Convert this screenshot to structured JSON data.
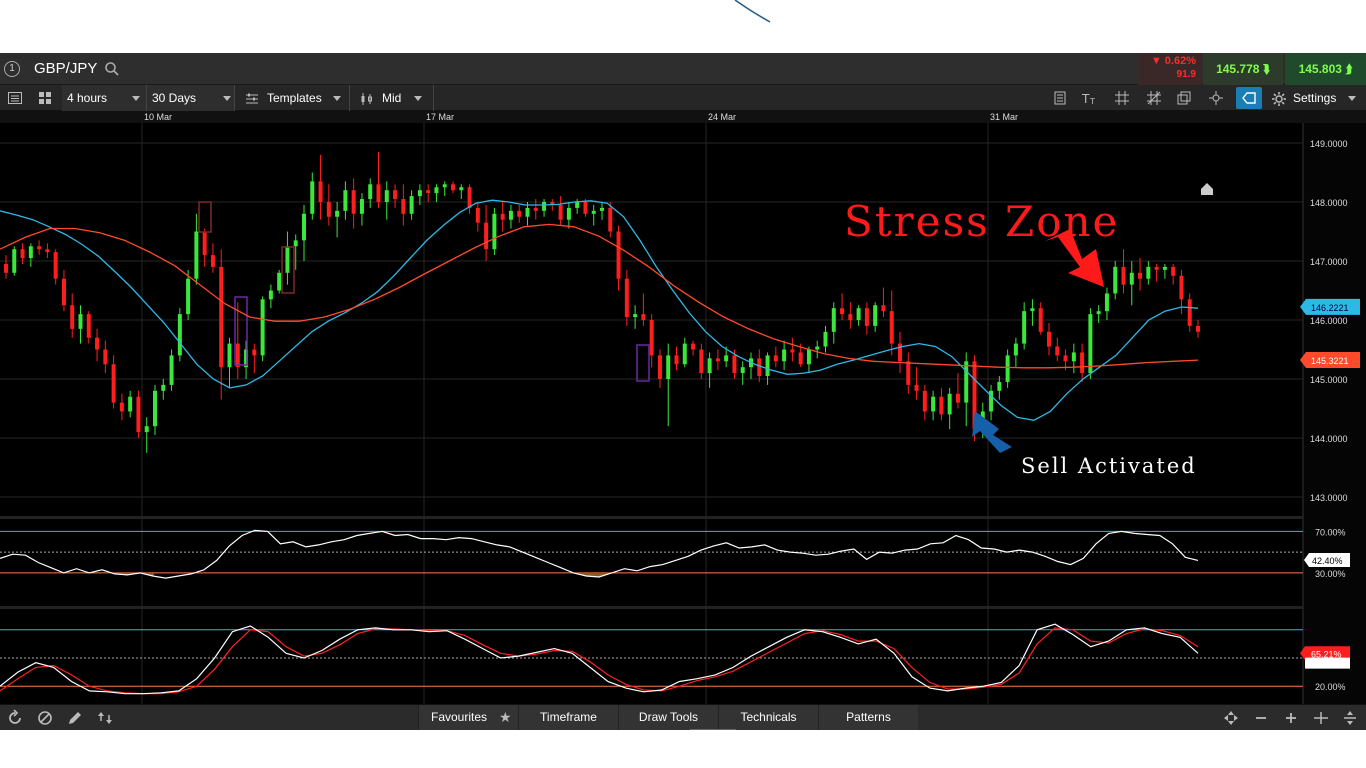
{
  "header": {
    "index_label": "1",
    "symbol": "GBP/JPY",
    "change_pct": "▼ 0.62%",
    "change_pts": "91.9",
    "bid": "145.778",
    "ask": "145.803"
  },
  "toolbar": {
    "interval": "4 hours",
    "range": "30 Days",
    "templates": "Templates",
    "price_type": "Mid",
    "settings": "Settings"
  },
  "bottombar": {
    "favourites": "Favourites",
    "timeframe": "Timeframe",
    "draw_tools": "Draw Tools",
    "technicals": "Technicals",
    "patterns": "Patterns"
  },
  "annotations": {
    "stress_zone": "Stress Zone",
    "sell_activated": "Sell Activated"
  },
  "colors": {
    "bull": "#39e83a",
    "bear": "#ff1e1e",
    "ma_fast": "#2db9e6",
    "ma_slow": "#ff4a2b",
    "annotation_red": "#ff1a1a",
    "arrow_blue": "#1560a8"
  },
  "chart_data": {
    "type": "candlestick",
    "symbol": "GBP/JPY",
    "x_labels": [
      "10 Mar",
      "17 Mar",
      "24 Mar",
      "31 Mar"
    ],
    "y_ticks": [
      "149.0000",
      "148.0000",
      "147.0000",
      "146.0000",
      "145.0000",
      "144.0000",
      "143.0000"
    ],
    "y_range": [
      143,
      149
    ],
    "price_tags": [
      {
        "value": "146.2221",
        "color": "#2db9e6"
      },
      {
        "value": "145.3221",
        "color": "#ff4a2b"
      }
    ],
    "ohlc": [
      [
        146.95,
        147.1,
        146.7,
        146.8
      ],
      [
        146.8,
        147.25,
        146.75,
        147.2
      ],
      [
        147.2,
        147.3,
        146.95,
        147.05
      ],
      [
        147.05,
        147.3,
        146.9,
        147.25
      ],
      [
        147.25,
        147.35,
        147.1,
        147.2
      ],
      [
        147.2,
        147.3,
        147.05,
        147.15
      ],
      [
        147.15,
        147.2,
        146.6,
        146.7
      ],
      [
        146.7,
        146.85,
        146.15,
        146.25
      ],
      [
        146.25,
        146.45,
        145.7,
        145.85
      ],
      [
        145.85,
        146.25,
        145.6,
        146.1
      ],
      [
        146.1,
        146.15,
        145.6,
        145.7
      ],
      [
        145.7,
        145.85,
        145.3,
        145.5
      ],
      [
        145.5,
        145.65,
        145.1,
        145.25
      ],
      [
        145.25,
        145.4,
        144.5,
        144.6
      ],
      [
        144.6,
        144.75,
        144.3,
        144.45
      ],
      [
        144.45,
        144.8,
        144.35,
        144.7
      ],
      [
        144.7,
        144.8,
        144.0,
        144.1
      ],
      [
        144.1,
        144.35,
        143.75,
        144.2
      ],
      [
        144.2,
        144.9,
        144.05,
        144.8
      ],
      [
        144.8,
        145.0,
        144.65,
        144.9
      ],
      [
        144.9,
        145.5,
        144.8,
        145.4
      ],
      [
        145.4,
        146.2,
        145.3,
        146.1
      ],
      [
        146.1,
        146.85,
        146.0,
        146.7
      ],
      [
        146.7,
        147.8,
        146.6,
        147.5
      ],
      [
        147.5,
        147.55,
        146.9,
        147.1
      ],
      [
        147.1,
        147.3,
        146.8,
        146.9
      ],
      [
        146.9,
        147.2,
        144.65,
        145.2
      ],
      [
        145.2,
        145.7,
        144.85,
        145.6
      ],
      [
        145.6,
        146.3,
        145.0,
        145.2
      ],
      [
        145.2,
        145.65,
        145.0,
        145.5
      ],
      [
        145.5,
        145.6,
        145.1,
        145.4
      ],
      [
        145.4,
        146.4,
        145.3,
        146.35
      ],
      [
        146.35,
        146.6,
        146.2,
        146.5
      ],
      [
        146.5,
        146.85,
        146.45,
        146.8
      ],
      [
        146.8,
        147.5,
        146.6,
        147.25
      ],
      [
        147.25,
        147.45,
        146.85,
        147.35
      ],
      [
        147.35,
        147.95,
        147.0,
        147.8
      ],
      [
        147.8,
        148.5,
        147.7,
        148.35
      ],
      [
        148.35,
        148.8,
        147.7,
        148.0
      ],
      [
        148.0,
        148.3,
        147.6,
        147.75
      ],
      [
        147.75,
        148.0,
        147.4,
        147.85
      ],
      [
        147.85,
        148.35,
        147.7,
        148.2
      ],
      [
        148.2,
        148.4,
        147.55,
        147.8
      ],
      [
        147.8,
        148.15,
        147.6,
        148.05
      ],
      [
        148.05,
        148.4,
        147.9,
        148.3
      ],
      [
        148.3,
        148.85,
        147.9,
        148.0
      ],
      [
        148.0,
        148.35,
        147.7,
        148.2
      ],
      [
        148.2,
        148.3,
        147.9,
        148.05
      ],
      [
        148.05,
        148.3,
        147.6,
        147.8
      ],
      [
        147.8,
        148.2,
        147.7,
        148.1
      ],
      [
        148.1,
        148.3,
        147.95,
        148.2
      ],
      [
        148.2,
        148.3,
        148.0,
        148.15
      ],
      [
        148.15,
        148.3,
        148.0,
        148.25
      ],
      [
        148.25,
        148.35,
        148.1,
        148.3
      ],
      [
        148.3,
        148.35,
        148.15,
        148.2
      ],
      [
        148.2,
        148.3,
        148.05,
        148.25
      ],
      [
        148.25,
        148.3,
        147.8,
        147.9
      ],
      [
        147.9,
        148.0,
        147.5,
        147.65
      ],
      [
        147.65,
        147.95,
        147.0,
        147.2
      ],
      [
        147.2,
        147.9,
        147.1,
        147.8
      ],
      [
        147.8,
        148.0,
        147.5,
        147.7
      ],
      [
        147.7,
        147.95,
        147.55,
        147.85
      ],
      [
        147.85,
        147.95,
        147.65,
        147.75
      ],
      [
        147.75,
        148.0,
        147.6,
        147.9
      ],
      [
        147.9,
        148.05,
        147.7,
        147.85
      ],
      [
        147.85,
        148.05,
        147.75,
        148.0
      ],
      [
        148.0,
        148.05,
        147.85,
        147.95
      ],
      [
        147.95,
        148.1,
        147.6,
        147.7
      ],
      [
        147.7,
        148.0,
        147.55,
        147.9
      ],
      [
        147.9,
        148.05,
        147.8,
        148.0
      ],
      [
        148.0,
        148.05,
        147.75,
        147.8
      ],
      [
        147.8,
        147.95,
        147.6,
        147.85
      ],
      [
        147.85,
        148.0,
        147.7,
        147.9
      ],
      [
        147.9,
        148.0,
        147.4,
        147.5
      ],
      [
        147.5,
        147.6,
        146.5,
        146.7
      ],
      [
        146.7,
        146.85,
        145.9,
        146.05
      ],
      [
        146.05,
        146.25,
        145.85,
        146.1
      ],
      [
        146.1,
        146.45,
        145.9,
        146.0
      ],
      [
        146.0,
        146.1,
        145.2,
        145.4
      ],
      [
        145.4,
        145.5,
        144.85,
        145.0
      ],
      [
        145.0,
        145.6,
        144.2,
        145.4
      ],
      [
        145.4,
        145.55,
        145.15,
        145.25
      ],
      [
        145.25,
        145.7,
        145.2,
        145.6
      ],
      [
        145.6,
        145.65,
        145.4,
        145.5
      ],
      [
        145.5,
        145.6,
        145.0,
        145.1
      ],
      [
        145.1,
        145.45,
        144.85,
        145.35
      ],
      [
        145.35,
        145.5,
        145.15,
        145.3
      ],
      [
        145.3,
        145.55,
        145.2,
        145.4
      ],
      [
        145.4,
        145.5,
        145.0,
        145.1
      ],
      [
        145.1,
        145.3,
        144.9,
        145.2
      ],
      [
        145.2,
        145.45,
        145.0,
        145.35
      ],
      [
        145.35,
        145.5,
        144.95,
        145.05
      ],
      [
        145.05,
        145.45,
        144.9,
        145.4
      ],
      [
        145.4,
        145.55,
        145.2,
        145.3
      ],
      [
        145.3,
        145.65,
        145.15,
        145.5
      ],
      [
        145.5,
        145.7,
        145.3,
        145.45
      ],
      [
        145.45,
        145.6,
        145.2,
        145.25
      ],
      [
        145.25,
        145.55,
        145.1,
        145.5
      ],
      [
        145.5,
        145.65,
        145.35,
        145.55
      ],
      [
        145.55,
        145.9,
        145.45,
        145.8
      ],
      [
        145.8,
        146.3,
        145.6,
        146.2
      ],
      [
        146.2,
        146.45,
        146.0,
        146.1
      ],
      [
        146.1,
        146.3,
        145.85,
        146.0
      ],
      [
        146.0,
        146.25,
        145.9,
        146.2
      ],
      [
        146.2,
        146.3,
        145.75,
        145.9
      ],
      [
        145.9,
        146.3,
        145.8,
        146.25
      ],
      [
        146.25,
        146.55,
        146.05,
        146.15
      ],
      [
        146.15,
        146.5,
        145.4,
        145.6
      ],
      [
        145.6,
        145.8,
        145.1,
        145.3
      ],
      [
        145.3,
        145.45,
        144.75,
        144.9
      ],
      [
        144.9,
        145.2,
        144.65,
        144.8
      ],
      [
        144.8,
        144.9,
        144.3,
        144.45
      ],
      [
        144.45,
        144.8,
        144.3,
        144.7
      ],
      [
        144.7,
        144.85,
        144.3,
        144.4
      ],
      [
        144.4,
        144.85,
        144.15,
        144.75
      ],
      [
        144.75,
        145.1,
        144.5,
        144.6
      ],
      [
        144.6,
        145.45,
        144.2,
        145.3
      ],
      [
        145.3,
        145.4,
        143.95,
        144.15
      ],
      [
        144.15,
        144.6,
        144.0,
        144.45
      ],
      [
        144.45,
        144.9,
        144.3,
        144.8
      ],
      [
        144.8,
        145.05,
        144.65,
        144.95
      ],
      [
        144.95,
        145.5,
        144.85,
        145.4
      ],
      [
        145.4,
        145.7,
        145.2,
        145.6
      ],
      [
        145.6,
        146.3,
        145.5,
        146.15
      ],
      [
        146.15,
        146.35,
        145.9,
        146.2
      ],
      [
        146.2,
        146.3,
        145.75,
        145.8
      ],
      [
        145.8,
        145.95,
        145.4,
        145.55
      ],
      [
        145.55,
        145.7,
        145.3,
        145.4
      ],
      [
        145.4,
        145.5,
        145.15,
        145.3
      ],
      [
        145.3,
        145.6,
        145.1,
        145.45
      ],
      [
        145.45,
        145.6,
        144.95,
        145.1
      ],
      [
        145.1,
        146.2,
        145.0,
        146.1
      ],
      [
        146.1,
        146.25,
        145.95,
        146.15
      ],
      [
        146.15,
        146.55,
        146.0,
        146.45
      ],
      [
        146.45,
        147.0,
        146.35,
        146.9
      ],
      [
        146.9,
        147.2,
        146.45,
        146.6
      ],
      [
        146.6,
        147.0,
        146.25,
        146.8
      ],
      [
        146.8,
        147.05,
        146.5,
        146.7
      ],
      [
        146.7,
        147.0,
        146.6,
        146.9
      ],
      [
        146.9,
        146.95,
        146.65,
        146.85
      ],
      [
        146.85,
        146.95,
        146.7,
        146.9
      ],
      [
        146.9,
        146.95,
        146.6,
        146.75
      ],
      [
        146.75,
        146.85,
        146.1,
        146.35
      ],
      [
        146.35,
        146.45,
        145.8,
        145.9
      ],
      [
        145.9,
        146.0,
        145.7,
        145.8
      ]
    ],
    "ma_fast": [
      147.85,
      147.78,
      147.7,
      147.58,
      147.45,
      147.28,
      147.08,
      146.82,
      146.55,
      146.25,
      145.95,
      145.6,
      145.25,
      145.0,
      144.85,
      144.9,
      145.05,
      145.3,
      145.55,
      145.8,
      145.98,
      146.12,
      146.28,
      146.48,
      146.75,
      147.05,
      147.35,
      147.6,
      147.82,
      147.98,
      148.03,
      148.0,
      147.95,
      147.95,
      147.96,
      148.0,
      148.02,
      147.98,
      147.75,
      147.35,
      146.9,
      146.5,
      146.12,
      145.8,
      145.55,
      145.38,
      145.25,
      145.15,
      145.08,
      145.1,
      145.15,
      145.25,
      145.32,
      145.4,
      145.48,
      145.55,
      145.6,
      145.55,
      145.38,
      145.1,
      144.82,
      144.55,
      144.35,
      144.3,
      144.45,
      144.75,
      145.0,
      145.2,
      145.4,
      145.7,
      146.0,
      146.15,
      146.22,
      146.2
    ],
    "ma_slow": [
      147.2,
      147.4,
      147.55,
      147.55,
      147.48,
      147.35,
      147.15,
      146.92,
      146.6,
      146.28,
      146.05,
      145.98,
      145.98,
      146.05,
      146.18,
      146.35,
      146.55,
      146.78,
      147.0,
      147.22,
      147.42,
      147.58,
      147.62,
      147.58,
      147.42,
      147.18,
      146.9,
      146.58,
      146.3,
      146.05,
      145.85,
      145.68,
      145.55,
      145.43,
      145.35,
      145.3,
      145.28,
      145.26,
      145.24,
      145.22,
      145.2,
      145.19,
      145.19,
      145.2,
      145.22,
      145.25,
      145.28,
      145.3,
      145.32
    ]
  }
}
